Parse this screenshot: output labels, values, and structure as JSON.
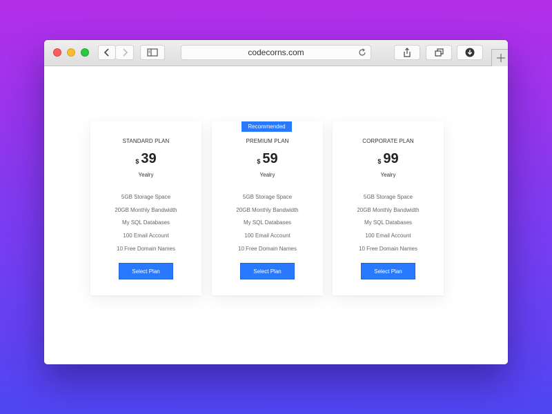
{
  "browser": {
    "url": "codecorns.com"
  },
  "plans": [
    {
      "name": "STANDARD PLAN",
      "currency": "$",
      "price": "39",
      "period": "Yealry",
      "features": [
        "5GB Storage Space",
        "20GB Monthly Bandwidth",
        "My SQL Databases",
        "100 Email Account",
        "10 Free Domain Names"
      ],
      "button_label": "Select Plan"
    },
    {
      "badge": "Recommended",
      "name": "PREMIUM PLAN",
      "currency": "$",
      "price": "59",
      "period": "Yealry",
      "features": [
        "5GB Storage Space",
        "20GB Monthly Bandwidth",
        "My SQL Databases",
        "100 Email Account",
        "10 Free Domain Names"
      ],
      "button_label": "Select Plan"
    },
    {
      "name": "CORPORATE PLAN",
      "currency": "$",
      "price": "99",
      "period": "Yealry",
      "features": [
        "5GB Storage Space",
        "20GB Monthly Bandwidth",
        "My SQL Databases",
        "100 Email Account",
        "10 Free Domain Names"
      ],
      "button_label": "Select Plan"
    }
  ],
  "colors": {
    "accent": "#2979ff",
    "background_top": "#b52ee8",
    "background_bottom": "#4f46f2"
  },
  "icons": [
    "back-icon",
    "forward-icon",
    "sidebar-icon",
    "reload-icon",
    "share-icon",
    "tabs-icon",
    "download-icon",
    "plus-icon"
  ]
}
